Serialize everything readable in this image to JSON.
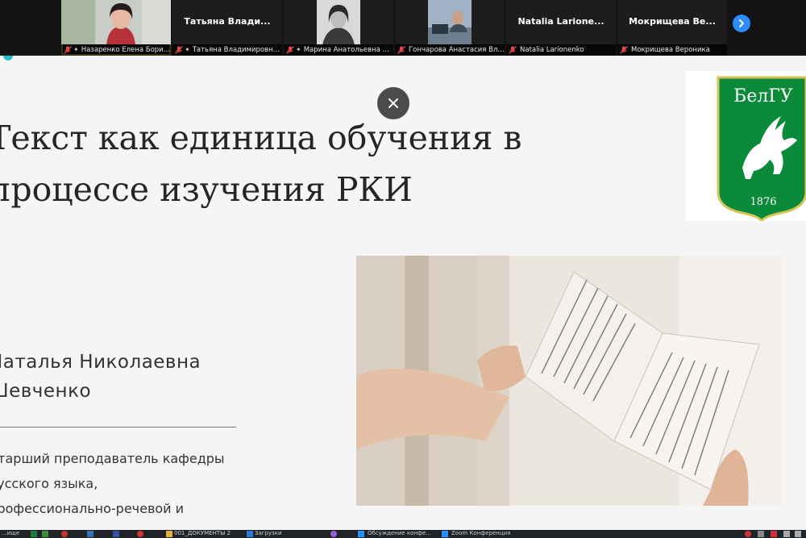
{
  "participants": [
    {
      "name_label": "Назаренко Елена Борисо...",
      "big_name": "",
      "muted": true,
      "pinned": true,
      "has_video": true,
      "active_speaker": true
    },
    {
      "name_label": "Татьяна Владимировна С...",
      "big_name": "Татьяна  Влади...",
      "muted": true,
      "pinned": true,
      "has_video": false,
      "active_speaker": false
    },
    {
      "name_label": "Марина Анатольевна Др...",
      "big_name": "",
      "muted": true,
      "pinned": true,
      "has_video": true,
      "active_speaker": false
    },
    {
      "name_label": "Гончарова Анастасия Влади...",
      "big_name": "",
      "muted": true,
      "pinned": false,
      "has_video": true,
      "active_speaker": false
    },
    {
      "name_label": "Natalia Larionenko",
      "big_name": "Natalia  Larione...",
      "muted": true,
      "pinned": false,
      "has_video": false,
      "active_speaker": false
    },
    {
      "name_label": "Мокрищева Вероника",
      "big_name": "Мокрищева  Ве...",
      "muted": true,
      "pinned": false,
      "has_video": false,
      "active_speaker": false
    }
  ],
  "strip_icons": {
    "next": "chevron-right-icon",
    "muted": "mic-muted-icon",
    "pin": "pin-icon"
  },
  "slide": {
    "title_line1": "Текст как единица обучения в",
    "title_line2": "процессе изучения РКИ",
    "author_line1": "Наталья Николаевна",
    "author_line2": "Шевченко",
    "desc_line1": "Старший преподаватель кафедры",
    "desc_line2": "русского языка,",
    "desc_line3": "профессионально-речевой и",
    "logo_text": "БелГУ",
    "logo_year": "1876"
  },
  "taskbar": {
    "item1": "...ище",
    "item2": "001_ДОКУМЕНТЫ 2",
    "item3": "Загрузки",
    "item4": "Обсуждение конфе...",
    "item5": "Zoom Конференция"
  },
  "colors": {
    "zoom_blue": "#2d8cff",
    "muted_red": "#e0484b",
    "active_speaker": "#e1c84a",
    "logo_green": "#0b8a3a",
    "slide_bg": "#f6f5f5"
  }
}
